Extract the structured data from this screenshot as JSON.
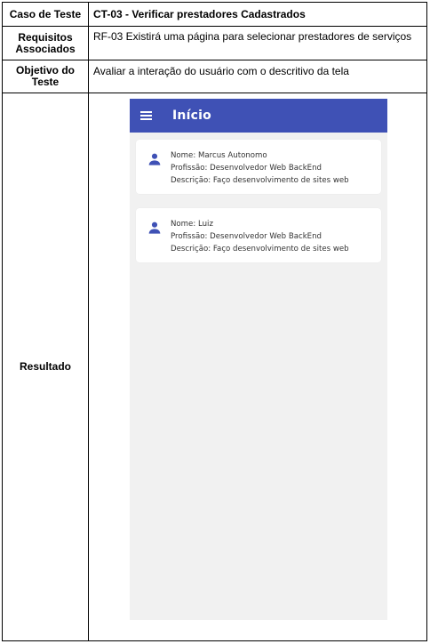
{
  "table": {
    "rows": [
      {
        "label": "Caso de Teste",
        "value": "CT-03 - Verificar prestadores Cadastrados"
      },
      {
        "label": "Requisitos Associados",
        "value": "RF-03 Existirá uma página para selecionar prestadores de serviços"
      },
      {
        "label": "Objetivo do Teste",
        "value": "Avaliar a interação do usuário com o descritivo da tela"
      },
      {
        "label": "Resultado"
      }
    ]
  },
  "app": {
    "title": "Início",
    "appbar_color": "#3f51b5",
    "background_color": "#f1f1f1",
    "menu_icon": "menu-icon",
    "card_icon": "person-icon",
    "providers": [
      {
        "name": "Nome: Marcus Autonomo",
        "profession": "Profissão: Desenvolvedor Web BackEnd",
        "description": "Descrição: Faço desenvolvimento de sites web"
      },
      {
        "name": "Nome: Luiz",
        "profession": "Profissão: Desenvolvedor Web BackEnd",
        "description": "Descrição: Faço desenvolvimento de sites web"
      }
    ]
  }
}
